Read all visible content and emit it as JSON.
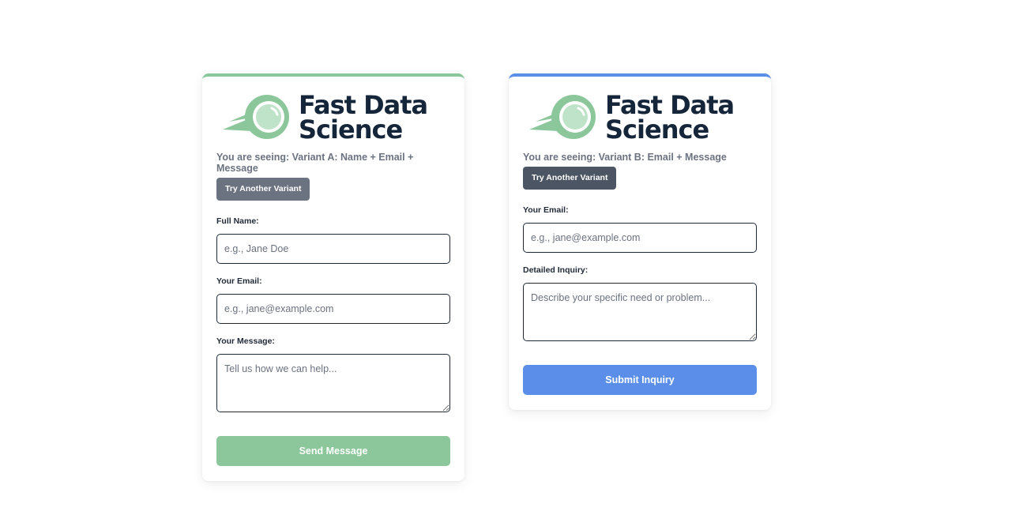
{
  "brand": {
    "line1": "Fast Data",
    "line2": "Science",
    "logo_icon": "magnifier-comet-icon",
    "green": "#8bc79a",
    "navy": "#16263a",
    "blue": "#5a8ee9"
  },
  "variant_a": {
    "seeing_text": "You are seeing: Variant A: Name + Email + Message",
    "try_button": "Try Another Variant",
    "name_label": "Full Name:",
    "name_placeholder": "e.g., Jane Doe",
    "email_label": "Your Email:",
    "email_placeholder": "e.g., jane@example.com",
    "message_label": "Your Message:",
    "message_placeholder": "Tell us how we can help...",
    "submit_label": "Send Message"
  },
  "variant_b": {
    "seeing_text": "You are seeing: Variant B: Email + Message",
    "try_button": "Try Another Variant",
    "email_label": "Your Email:",
    "email_placeholder": "e.g., jane@example.com",
    "inquiry_label": "Detailed Inquiry:",
    "inquiry_placeholder": "Describe your specific need or problem...",
    "submit_label": "Submit Inquiry"
  }
}
